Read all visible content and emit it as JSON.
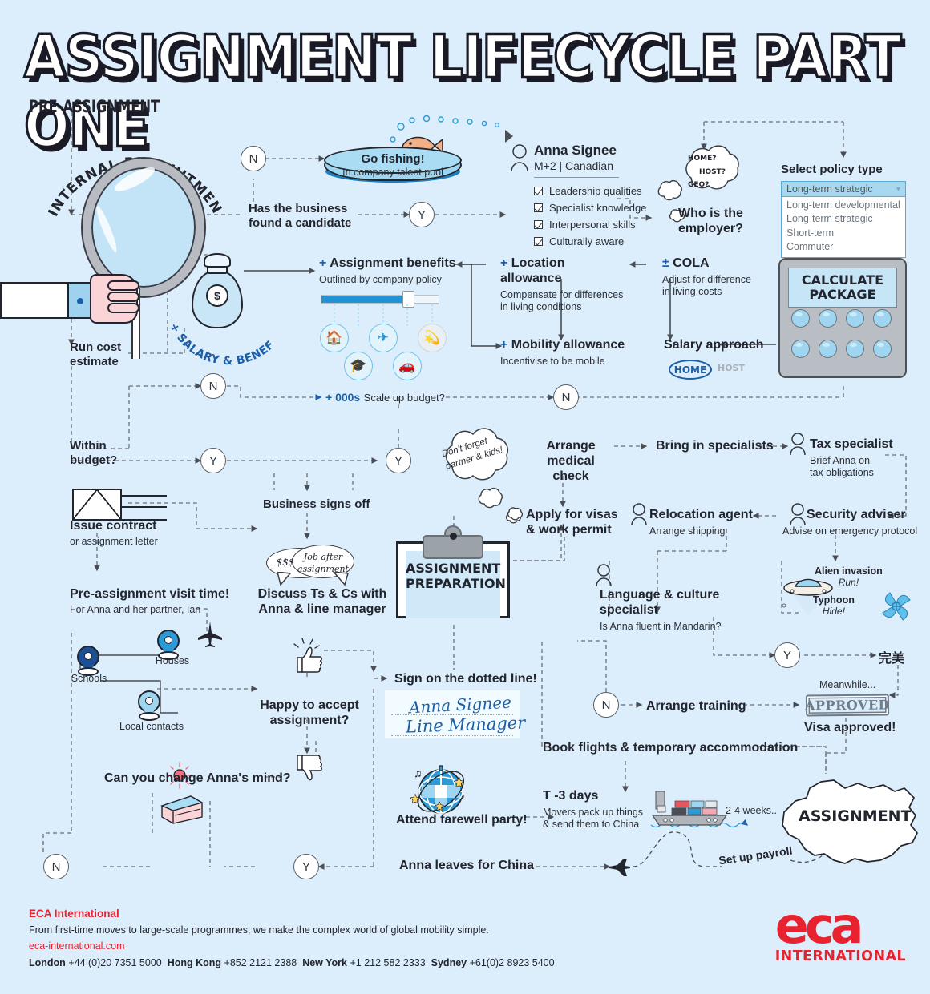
{
  "header": {
    "title": "ASSIGNMENT LIFECYCLE PART ONE",
    "subtitle": "PRE-ASSIGNMENT"
  },
  "recruitment": {
    "arc_label": "INTERNAL RECRUITMENT",
    "run_cost_title": "Run cost",
    "run_cost_sub": "estimate",
    "decision_has_candidate": "Has the business",
    "decision_has_candidate_2": "found a candidate",
    "node_n": "N",
    "node_y": "Y",
    "fishing_title": "Go fishing!",
    "fishing_sub": "In company talent pool"
  },
  "candidate": {
    "name": "Anna Signee",
    "meta": "M+2 | Canadian",
    "checks": [
      "Leadership qualities",
      "Specialist knowledge",
      "Interpersonal skills",
      "Culturally aware"
    ]
  },
  "employer": {
    "cloud_lines": [
      "HOME?",
      "HOST?",
      "GEO?"
    ],
    "question_l1": "Who is the",
    "question_l2": "employer?"
  },
  "policy": {
    "label": "Select policy type",
    "selected": "Long-term strategic",
    "options": [
      "Long-term developmental",
      "Long-term strategic",
      "Short-term",
      "Commuter"
    ]
  },
  "package": {
    "bag_arc": "+ SALARY & BENEFITS PACKAGE",
    "bag_symbol": "$",
    "benefits_title": "Assignment benefits",
    "benefits_plus": "+",
    "benefits_sub": "Outlined by company policy",
    "benefit_icons": [
      "home-icon",
      "plane-icon",
      "dumbbell-icon",
      "graduation-cap-icon",
      "car-icon"
    ],
    "location_plus": "+",
    "location_title": "Location allowance",
    "location_sub_l1": "Compensate for differences",
    "location_sub_l2": "in living conditions",
    "mobility_plus": "+",
    "mobility_title": "Mobility allowance",
    "mobility_sub": "Incentivise to be mobile",
    "cola_plus": "±",
    "cola_title": "COLA",
    "cola_sub_l1": "Adjust for difference",
    "cola_sub_l2": "in living costs",
    "salary_approach": "Salary approach",
    "home_toggle": "HOME",
    "host_toggle": "HOST",
    "calculate_l1": "CALCULATE",
    "calculate_l2": "PACKAGE"
  },
  "budget": {
    "within_l1": "Within",
    "within_l2": "budget?",
    "node_n": "N",
    "node_y": "Y",
    "scale_plus": "+ 000s",
    "scale_text": "Scale up budget?",
    "node_y2": "Y",
    "node_n2": "N",
    "business_signs_off": "Business signs off"
  },
  "contract": {
    "issue_title": "Issue contract",
    "issue_sub": "or assignment letter",
    "visit_title": "Pre-assignment visit time!",
    "visit_sub": "For Anna and her partner, Ian",
    "pins": [
      {
        "label": "Houses",
        "color": "#2b9ad6"
      },
      {
        "label": "Schools",
        "color": "#1b4f96"
      },
      {
        "label": "Local contacts",
        "color": "#9ed6f2"
      }
    ],
    "change_mind": "Can you change Anna's mind?",
    "node_n": "N",
    "node_y": "Y"
  },
  "discuss": {
    "bubble_money": "$$$",
    "bubble_job_l1": "Job after",
    "bubble_job_l2": "assignment",
    "title_l1": "Discuss Ts & Cs with",
    "title_l2": "Anna & line manager"
  },
  "prep": {
    "clipboard_l1": "ASSIGNMENT",
    "clipboard_l2": "PREPARATION",
    "happy_l1": "Happy to accept",
    "happy_l2": "assignment?",
    "sign_title": "Sign on the dotted line!",
    "sig_1": "Anna Signee",
    "sig_2": "Line Manager"
  },
  "family": {
    "cloud_l1": "Don't forget",
    "cloud_l2": "partner & kids!"
  },
  "tasks": {
    "medical_l1": "Arrange medical",
    "medical_l2": "check",
    "visas_l1": "Apply for visas",
    "visas_l2": "& work permit",
    "bring_specialists": "Bring in specialists",
    "relocation_title": "Relocation agent",
    "relocation_sub": "Arrange shipping",
    "tax_title": "Tax specialist",
    "tax_sub_l1": "Brief Anna on",
    "tax_sub_l2": "tax obligations",
    "security_title": "Security adviser",
    "security_sub": "Advise on emergency protocol",
    "language_title": "Language & culture specialist",
    "language_sub": "Is Anna fluent in Mandarin?",
    "alien_title": "Alien invasion",
    "alien_sub": "Run!",
    "typhoon_title": "Typhoon",
    "typhoon_sub": "Hide!",
    "node_y": "Y",
    "node_n": "N",
    "perfect_cn": "完美",
    "arrange_training": "Arrange training",
    "meanwhile": "Meanwhile...",
    "approved_stamp": "APPROVED",
    "visa_approved": "Visa approved!"
  },
  "departure": {
    "book_flights": "Book flights & temporary accommodation",
    "t_minus": "T -3 days",
    "movers_l1": "Movers pack up things",
    "movers_l2": "& send them to China",
    "weeks": "2-4 weeks..",
    "farewell": "Attend farewell party!",
    "leaves": "Anna leaves for China",
    "payroll": "Set up payroll",
    "assignment": "ASSIGNMENT"
  },
  "footer": {
    "company": "ECA International",
    "tagline": "From first-time moves to large-scale programmes, we make the complex world of global mobility simple.",
    "website": "eca-international.com",
    "offices": [
      {
        "city": "London",
        "phone": "+44 (0)20 7351 5000"
      },
      {
        "city": "Hong Kong",
        "phone": "+852 2121 2388"
      },
      {
        "city": "New York",
        "phone": "+1 212 582 2333"
      },
      {
        "city": "Sydney",
        "phone": "+61(0)2 8923 5400"
      }
    ],
    "logo_text": "eca",
    "logo_sub": "INTERNATIONAL"
  },
  "colors": {
    "background": "#dceefb",
    "accent_blue": "#1f93d6",
    "dark_blue": "#1b5fa8",
    "red": "#e8232f",
    "ink": "#23252e"
  }
}
